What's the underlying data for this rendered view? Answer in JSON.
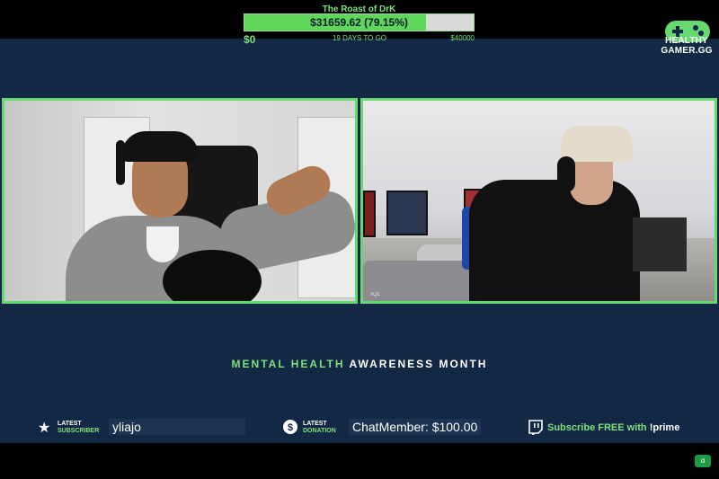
{
  "goal": {
    "title": "The Roast of DrK",
    "amount_text": "$31659.62 (79.15%)",
    "progress_fraction": 0.7915,
    "min_label": "$0",
    "days_label": "19 DAYS TO GO",
    "max_label": "$40000"
  },
  "logo": {
    "line1": "HEALTHY",
    "line2": "GAMER.GG",
    "icon": "gamepad-icon"
  },
  "video": {
    "right_tag": "xQc"
  },
  "awareness": {
    "accent": "MENTAL HEALTH",
    "rest": "AWARENESS MONTH"
  },
  "ticker": {
    "subscriber": {
      "label_top": "LATEST",
      "label_bottom": "SUBSCRIBER",
      "value": "yliajo",
      "icon": "star-icon"
    },
    "donation": {
      "label_top": "LATEST",
      "label_bottom": "DONATION",
      "value": "ChatMember: $100.00",
      "icon": "dollar-icon"
    },
    "prime": {
      "text_green": "Subscribe FREE with ",
      "text_white": "!prime",
      "icon": "twitch-icon"
    }
  },
  "colors": {
    "accent_green": "#67d770",
    "overlay_navy": "#122844"
  }
}
